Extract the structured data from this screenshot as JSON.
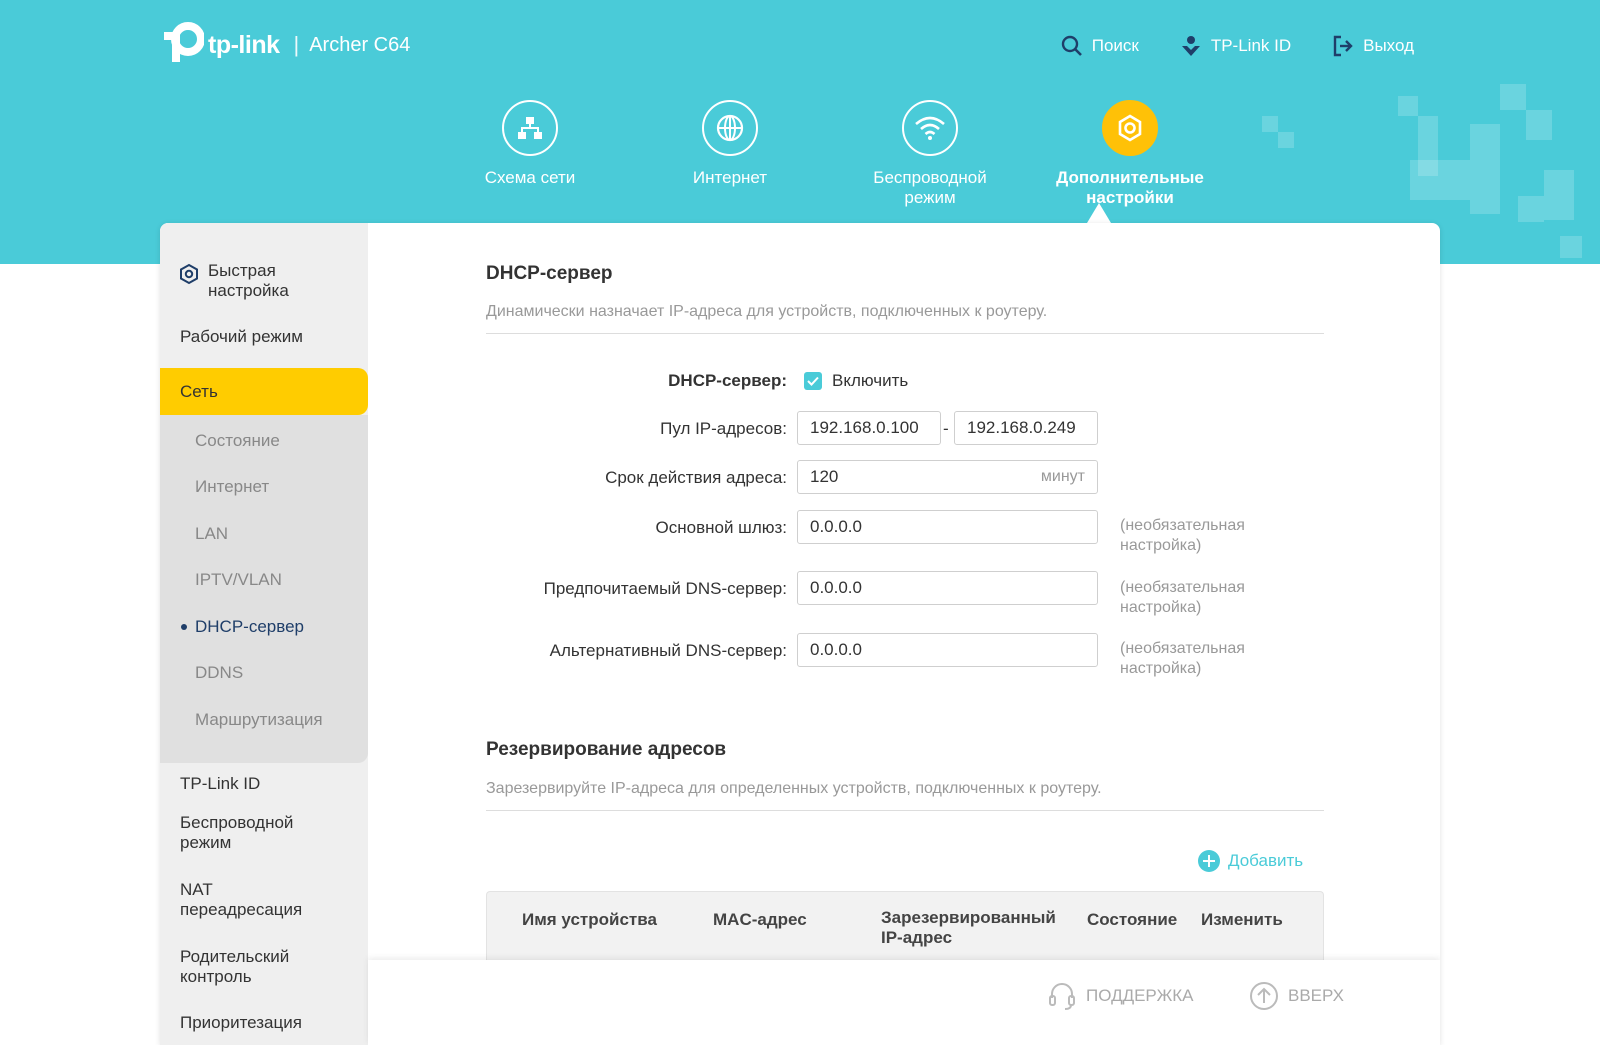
{
  "brand": {
    "logo_text": "tp-link",
    "separator": "|",
    "model": "Archer C64"
  },
  "top_links": {
    "search": "Поиск",
    "tplink_id": "TP-Link ID",
    "logout": "Выход"
  },
  "main_nav": {
    "network_map": "Схема сети",
    "internet": "Интернет",
    "wireless_line1": "Беспроводной",
    "wireless_line2": "режим",
    "advanced_line1": "Дополнительные",
    "advanced_line2": "настройки"
  },
  "sidebar": {
    "quick_setup_line1": "Быстрая",
    "quick_setup_line2": "настройка",
    "operation_mode": "Рабочий режим",
    "network": "Сеть",
    "sub": {
      "status": "Состояние",
      "internet": "Интернет",
      "lan": "LAN",
      "iptv": "IPTV/VLAN",
      "dhcp": "DHCP-сервер",
      "ddns": "DDNS",
      "routing": "Маршрутизация"
    },
    "tplink_id": "TP-Link ID",
    "wireless_line1": "Беспроводной",
    "wireless_line2": "режим",
    "nat_line1": "NAT",
    "nat_line2": "переадресация",
    "parental_line1": "Родительский",
    "parental_line2": "контроль",
    "qos": "Приоритезация"
  },
  "dhcp": {
    "title": "DHCP-сервер",
    "description": "Динамически назначает IP-адреса для устройств, подключенных к роутеру.",
    "server_label": "DHCP-сервер:",
    "enable_label": "Включить",
    "enabled": true,
    "pool_label": "Пул IP-адресов:",
    "pool_start": "192.168.0.100",
    "pool_dash": "-",
    "pool_end": "192.168.0.249",
    "lease_label": "Срок действия адреса:",
    "lease_value": "120",
    "lease_unit": "минут",
    "gateway_label": "Основной шлюз:",
    "gateway_value": "0.0.0.0",
    "dns1_label": "Предпочитаемый DNS-сервер:",
    "dns1_value": "0.0.0.0",
    "dns2_label": "Альтернативный DNS-сервер:",
    "dns2_value": "0.0.0.0",
    "optional_line1": "(необязательная",
    "optional_line2": "настройка)"
  },
  "reservation": {
    "title": "Резервирование адресов",
    "description": "Зарезервируйте IP-адреса для определенных устройств, подключенных к роутеру.",
    "add_label": "Добавить",
    "columns": {
      "device_name": "Имя устройства",
      "mac": "MAC-адрес",
      "reserved_ip_line1": "Зарезервированный",
      "reserved_ip_line2": "IP-адрес",
      "status": "Состояние",
      "modify": "Изменить"
    }
  },
  "footer": {
    "support": "ПОДДЕРЖКА",
    "back_to_top": "ВВЕРХ"
  },
  "colors": {
    "header_bg": "#4acbd8",
    "active_yellow": "#ffcc00",
    "accent": "#4acbd8"
  }
}
